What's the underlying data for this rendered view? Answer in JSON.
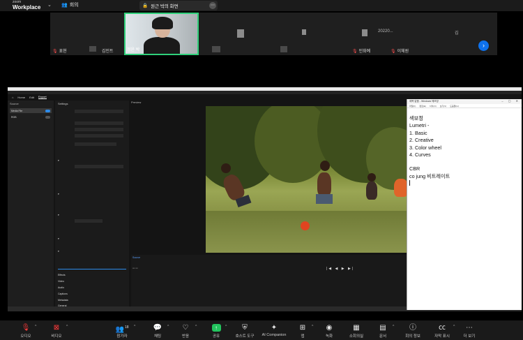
{
  "app": {
    "brand_top": "zoom",
    "brand_bottom": "Workplace",
    "meeting_tab": "회의",
    "share_label": "원근 박의 화면"
  },
  "participants": [
    {
      "name": "표현"
    },
    {
      "name": "김민트"
    },
    {
      "name": "정윤 박",
      "active_speaker": true
    },
    {
      "name": "20220..."
    },
    {
      "name": "김"
    },
    {
      "name": "민화예"
    },
    {
      "name": "이체원"
    }
  ],
  "editor": {
    "tabs": [
      "Home",
      "Edit",
      "Export"
    ],
    "left_header": "Source",
    "media_items": [
      "Media File",
      "RGB"
    ],
    "settings_title": "Settings",
    "sections": [
      "Effects",
      "Video",
      "Audio",
      "Captions",
      "Metadata",
      "General"
    ],
    "preview_label": "Preview",
    "timeline_label": "Source"
  },
  "notepad": {
    "title": "제목 없음 - Windows 메모장",
    "menu": [
      "파일(F)",
      "편집(E)",
      "서식(O)",
      "보기(V)",
      "도움말(H)"
    ],
    "lines": [
      "색보정",
      "Lumetri -",
      "1. Basic",
      "2. Creative",
      "3. Color wheel",
      "4. Curves",
      "",
      "CBR",
      "co jung 비트레이트"
    ]
  },
  "toolbar": {
    "items": [
      {
        "label": "오디오",
        "icon": "mic-muted-icon"
      },
      {
        "label": "비디오",
        "icon": "video-off-icon"
      },
      {
        "label": "참가자",
        "icon": "participants-icon",
        "count": "18"
      },
      {
        "label": "채팅",
        "icon": "chat-icon"
      },
      {
        "label": "반응",
        "icon": "reaction-icon"
      },
      {
        "label": "공유",
        "icon": "share-icon"
      },
      {
        "label": "호스트 도구",
        "icon": "shield-icon"
      },
      {
        "label": "AI Companion",
        "icon": "sparkle-icon"
      },
      {
        "label": "앱",
        "icon": "apps-icon"
      },
      {
        "label": "녹화",
        "icon": "record-icon"
      },
      {
        "label": "소회의실",
        "icon": "breakout-icon"
      },
      {
        "label": "문서",
        "icon": "docs-icon"
      },
      {
        "label": "회의 정보",
        "icon": "info-icon"
      },
      {
        "label": "자막 표시",
        "icon": "cc-icon"
      },
      {
        "label": "더 보기",
        "icon": "more-icon"
      }
    ]
  },
  "colors": {
    "accent": "#0e72ed",
    "active_border": "#2fd07a",
    "muted": "#ff3b3b",
    "share_green": "#23c45e"
  }
}
